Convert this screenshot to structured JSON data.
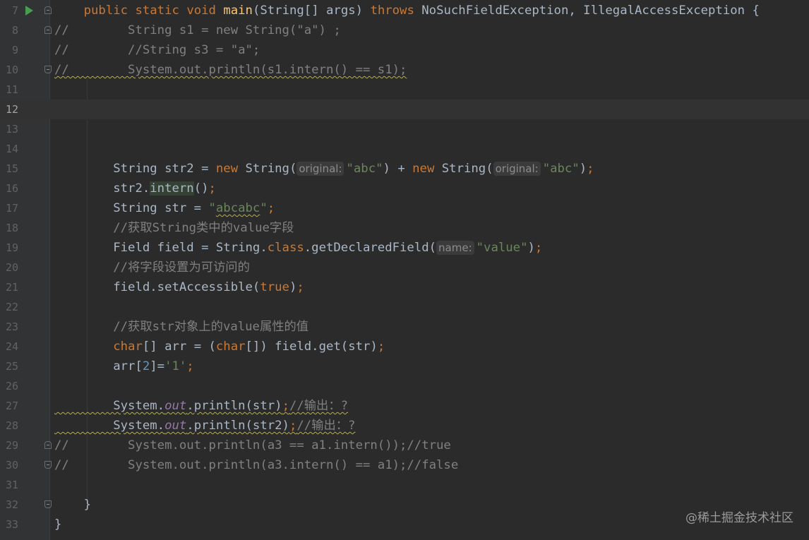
{
  "editor": {
    "watermark": "@稀土掘金技术社区",
    "lines": [
      {
        "n": "7"
      },
      {
        "n": "8"
      },
      {
        "n": "9"
      },
      {
        "n": "10"
      },
      {
        "n": "11"
      },
      {
        "n": "12"
      },
      {
        "n": "13"
      },
      {
        "n": "14"
      },
      {
        "n": "15"
      },
      {
        "n": "16"
      },
      {
        "n": "17"
      },
      {
        "n": "18"
      },
      {
        "n": "19"
      },
      {
        "n": "20"
      },
      {
        "n": "21"
      },
      {
        "n": "22"
      },
      {
        "n": "23"
      },
      {
        "n": "24"
      },
      {
        "n": "25"
      },
      {
        "n": "26"
      },
      {
        "n": "27"
      },
      {
        "n": "28"
      },
      {
        "n": "29"
      },
      {
        "n": "30"
      },
      {
        "n": "31"
      },
      {
        "n": "32"
      },
      {
        "n": "33"
      }
    ],
    "code": {
      "l7": {
        "pre": "    ",
        "public": "public",
        "static": "static",
        "void": "void",
        "main": "main",
        "sig": "(String[] args) ",
        "throws": "throws",
        "exc": " NoSuchFieldException, IllegalAccessException {"
      },
      "l8": "//        String s1 = new String(\"a\") ;",
      "l9": "//        //String s3 = \"a\";",
      "l10": "//        System.out.println(s1.intern() == s1);",
      "l15": {
        "pre": "        String str2 = ",
        "new1": "new",
        "mid1": " String(",
        "hint1": "original:",
        "s1": "\"abc\"",
        "plus": ") + ",
        "new2": "new",
        "mid2": " String(",
        "hint2": "original:",
        "s2": "\"abc\"",
        "end": ")",
        "semi": ";"
      },
      "l16": {
        "pre": "        str2.",
        "intern": "intern",
        "end": "()",
        "semi": ";"
      },
      "l17": {
        "pre": "        String str = ",
        "q1": "\"",
        "val": "abcabc",
        "q2": "\"",
        "semi": ";"
      },
      "l18": "        //获取String类中的value字段",
      "l19": {
        "pre": "        Field field = String.",
        "cls": "class",
        "mid": ".getDeclaredField(",
        "hint": "name:",
        "s": "\"value\"",
        "end": ")",
        "semi": ";"
      },
      "l20": "        //将字段设置为可访问的",
      "l21": {
        "pre": "        field.setAccessible(",
        "tr": "true",
        "end": ")",
        "semi": ";"
      },
      "l23": "        //获取str对象上的value属性的值",
      "l24": {
        "pre": "        ",
        "ch1": "char",
        "mid1": "[] arr = (",
        "ch2": "char",
        "mid2": "[]) field.get(str)",
        "semi": ";"
      },
      "l25": {
        "pre": "        arr[",
        "idx": "2",
        "mid": "]=",
        "ch": "'1'",
        "semi": ";"
      },
      "l27": {
        "pre": "        System.",
        "out": "out",
        "mid": ".println(str)",
        "semi": ";",
        "cm": "//输出：?"
      },
      "l28": {
        "pre": "        System.",
        "out": "out",
        "mid": ".println(str2)",
        "semi": ";",
        "cm": "//输出：?"
      },
      "l29": "//        System.out.println(a3 == a1.intern());//true",
      "l30": "//        System.out.println(a3.intern() == a1);//false",
      "l32": "    }",
      "l33": "}"
    }
  }
}
